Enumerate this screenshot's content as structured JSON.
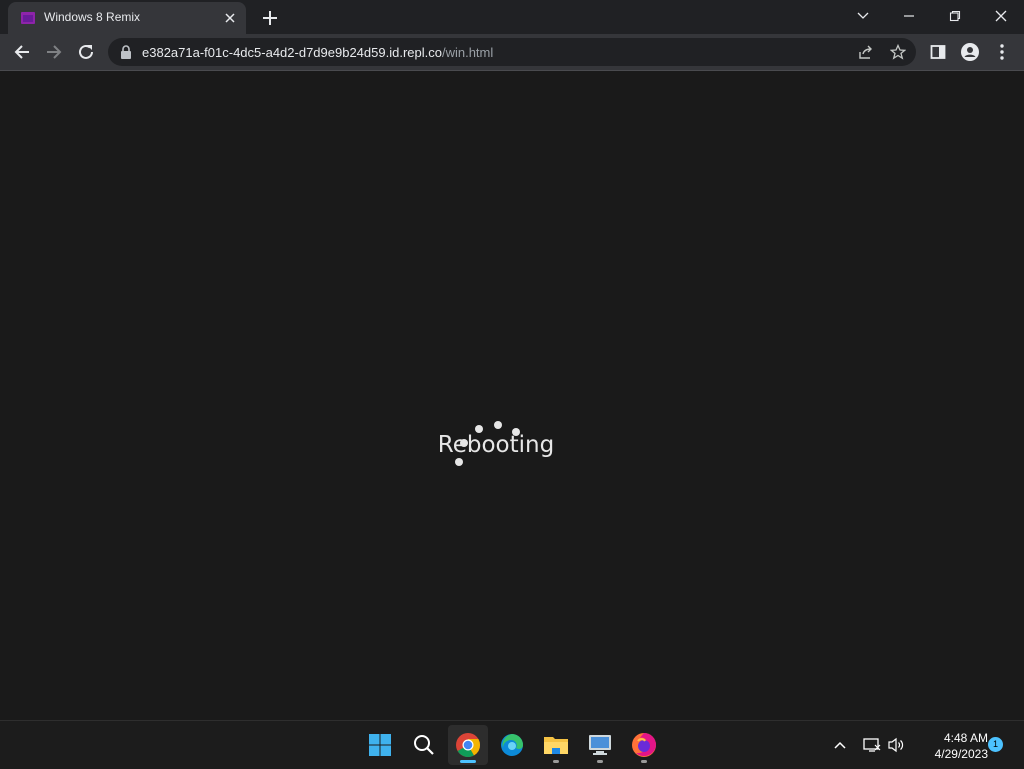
{
  "browser": {
    "tab": {
      "title": "Windows 8 Remix",
      "favicon": "purple-window-icon"
    },
    "address": {
      "host": "e382a71a-f01c-4dc5-a4d2-d7d9e9b24d59.id.repl.co",
      "path": "/win.html"
    }
  },
  "page": {
    "status_text": "Rebooting",
    "spinner_color": "#e6e6e6",
    "background": "#1a1a1a"
  },
  "taskbar": {
    "apps": [
      {
        "name": "start-button",
        "icon": "windows-logo-icon"
      },
      {
        "name": "search",
        "icon": "search-icon"
      },
      {
        "name": "chrome",
        "icon": "chrome-icon",
        "active": true
      },
      {
        "name": "edge",
        "icon": "edge-icon"
      },
      {
        "name": "file-explorer",
        "icon": "folder-icon"
      },
      {
        "name": "this-pc",
        "icon": "computer-icon"
      },
      {
        "name": "firefox",
        "icon": "firefox-icon"
      }
    ],
    "clock": {
      "time": "4:48 AM",
      "date": "4/29/2023"
    },
    "notification_count": "1",
    "accent": "#4cc2ff"
  }
}
